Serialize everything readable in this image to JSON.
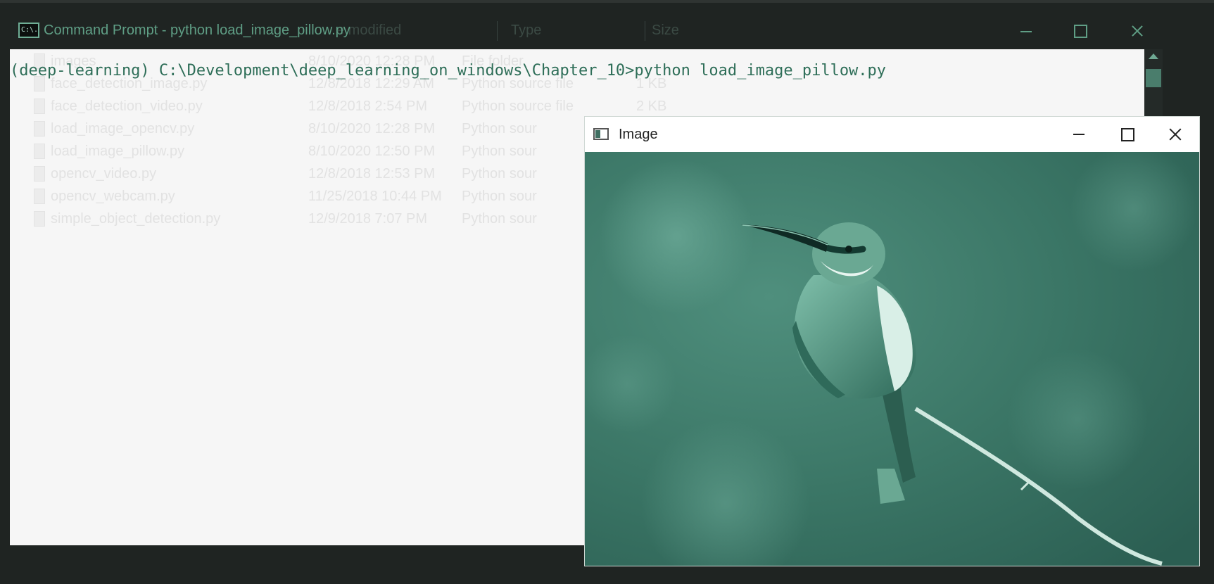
{
  "cmd_window": {
    "title": "Command Prompt - python  load_image_pillow.py",
    "icon_label": "C:\\.",
    "ghost_headers": {
      "date_modified": "e modified",
      "type": "Type",
      "size": "Size"
    },
    "command_line": "(deep-learning) C:\\Development\\deep_learning_on_windows\\Chapter_10>python load_image_pillow.py",
    "ghost_files": [
      {
        "name": "images",
        "date": "8/10/2020 12:28 PM",
        "type": "File folder",
        "size": ""
      },
      {
        "name": "face_detection_image.py",
        "date": "12/8/2018 12:29 AM",
        "type": "Python source file",
        "size": "1 KB"
      },
      {
        "name": "face_detection_video.py",
        "date": "12/8/2018 2:54 PM",
        "type": "Python source file",
        "size": "2 KB"
      },
      {
        "name": "load_image_opencv.py",
        "date": "8/10/2020 12:28 PM",
        "type": "Python sour",
        "size": ""
      },
      {
        "name": "load_image_pillow.py",
        "date": "8/10/2020 12:50 PM",
        "type": "Python sour",
        "size": ""
      },
      {
        "name": "opencv_video.py",
        "date": "12/8/2018 12:53 PM",
        "type": "Python sour",
        "size": ""
      },
      {
        "name": "opencv_webcam.py",
        "date": "11/25/2018 10:44 PM",
        "type": "Python sour",
        "size": ""
      },
      {
        "name": "simple_object_detection.py",
        "date": "12/9/2018 7:07 PM",
        "type": "Python sour",
        "size": ""
      }
    ]
  },
  "image_window": {
    "title": "Image"
  },
  "colors": {
    "accent_teal": "#5f9e85",
    "image_tint": "#3f7d6c",
    "background_dark": "#1f2422"
  }
}
